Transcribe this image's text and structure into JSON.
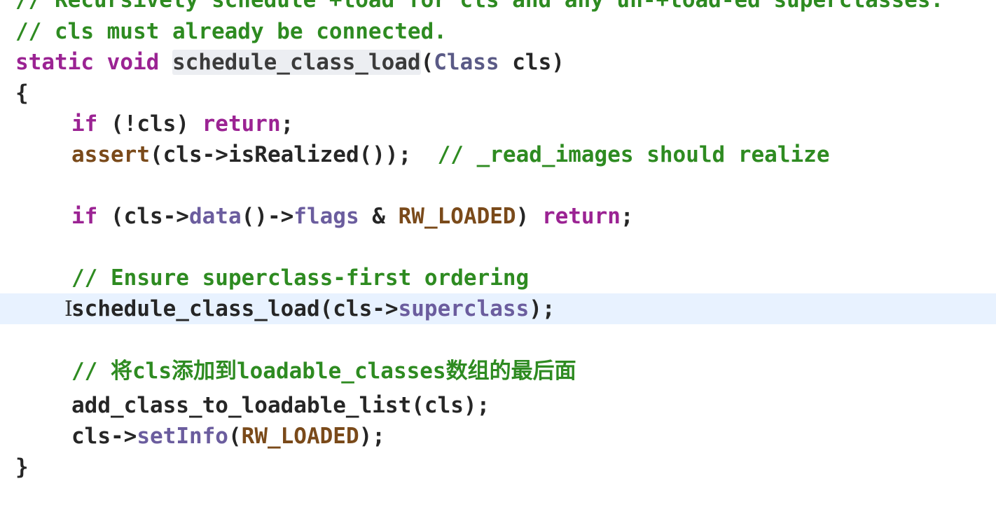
{
  "editor": {
    "lines": [
      {
        "text": "// Recursively schedule +load for cls and any un-+load-ed superclasses."
      },
      {
        "text": "// cls must already be connected."
      },
      {
        "kw1": "static",
        "kw2": "void",
        "fn": "schedule_class_load",
        "open": "(",
        "type": "Class",
        "param": "cls",
        "close": ")"
      },
      {
        "text": "{"
      },
      {
        "kw": "if",
        "a": " (!cls) ",
        "ret": "return",
        "b": ";"
      },
      {
        "fn": "assert",
        "a": "(cls->isRealized());  ",
        "cm": "// _read_images should realize"
      },
      {
        "kw": "if",
        "a": " (cls->",
        "m1": "data",
        "b": "()->",
        "m2": "flags",
        "c": " & ",
        "mac": "RW_LOADED",
        "d": ") ",
        "ret": "return",
        "e": ";"
      },
      {
        "text": "// Ensure superclass-first ordering"
      },
      {
        "a": "schedule_class_load(cls->",
        "m": "superclass",
        "b": ");"
      },
      {
        "text": "// 将cls添加到loadable_classes数组的最后面"
      },
      {
        "text": "add_class_to_loadable_list(cls);"
      },
      {
        "a": "cls->",
        "m": "setInfo",
        "b": "(",
        "mac": "RW_LOADED",
        "c": ");"
      },
      {
        "text": "}"
      }
    ]
  },
  "colors": {
    "comment": "#2e8b21",
    "keyword": "#9b2393",
    "type": "#5a5a86",
    "member": "#6b5d9e",
    "current_line": "#e8f2ff"
  },
  "cursor": {
    "icon": "text-cursor-ibeam-icon"
  }
}
